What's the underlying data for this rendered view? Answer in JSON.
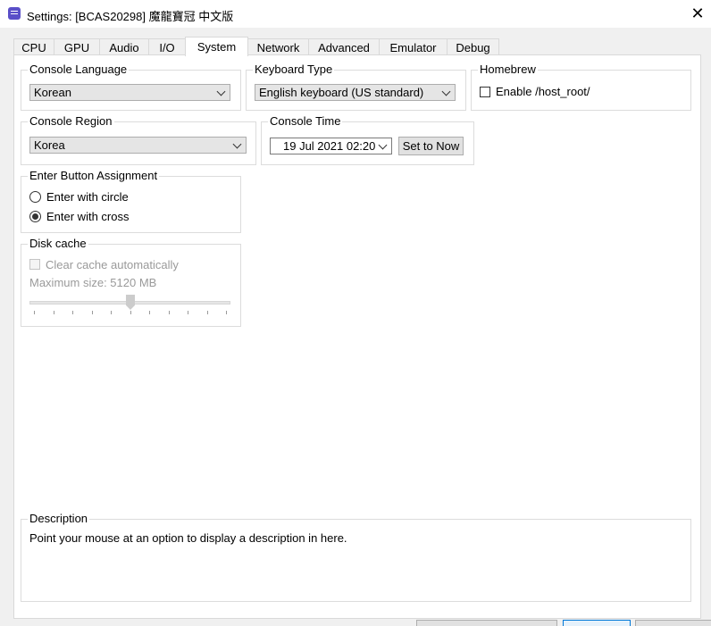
{
  "window": {
    "title": "Settings: [BCAS20298] 魔龍寶冠 中文版",
    "close_glyph": "✕"
  },
  "tabs": [
    {
      "label": "CPU"
    },
    {
      "label": "GPU"
    },
    {
      "label": "Audio"
    },
    {
      "label": "I/O"
    },
    {
      "label": "System"
    },
    {
      "label": "Network"
    },
    {
      "label": "Advanced"
    },
    {
      "label": "Emulator"
    },
    {
      "label": "Debug"
    }
  ],
  "active_tab": "System",
  "console_language": {
    "legend": "Console Language",
    "value": "Korean"
  },
  "keyboard_type": {
    "legend": "Keyboard Type",
    "value": "English keyboard (US standard)"
  },
  "homebrew": {
    "legend": "Homebrew",
    "checkbox_label": "Enable /host_root/",
    "checked": false
  },
  "console_region": {
    "legend": "Console Region",
    "value": "Korea"
  },
  "console_time": {
    "legend": "Console Time",
    "value": "19 Jul 2021 02:20",
    "set_now_label": "Set to Now"
  },
  "enter_button": {
    "legend": "Enter Button Assignment",
    "options": [
      {
        "label": "Enter with circle",
        "selected": false
      },
      {
        "label": "Enter with cross",
        "selected": true
      }
    ]
  },
  "disk_cache": {
    "legend": "Disk cache",
    "checkbox_label": "Clear cache automatically",
    "max_size_label": "Maximum size: 5120 MB",
    "slider_fraction": 0.5
  },
  "description": {
    "legend": "Description",
    "text": "Point your mouse at an option to display a description in here."
  },
  "colors": {
    "accent": "#0078d7",
    "panel": "#ffffff",
    "window": "#f0f0f0",
    "app_icon": "#5a4fc8"
  }
}
